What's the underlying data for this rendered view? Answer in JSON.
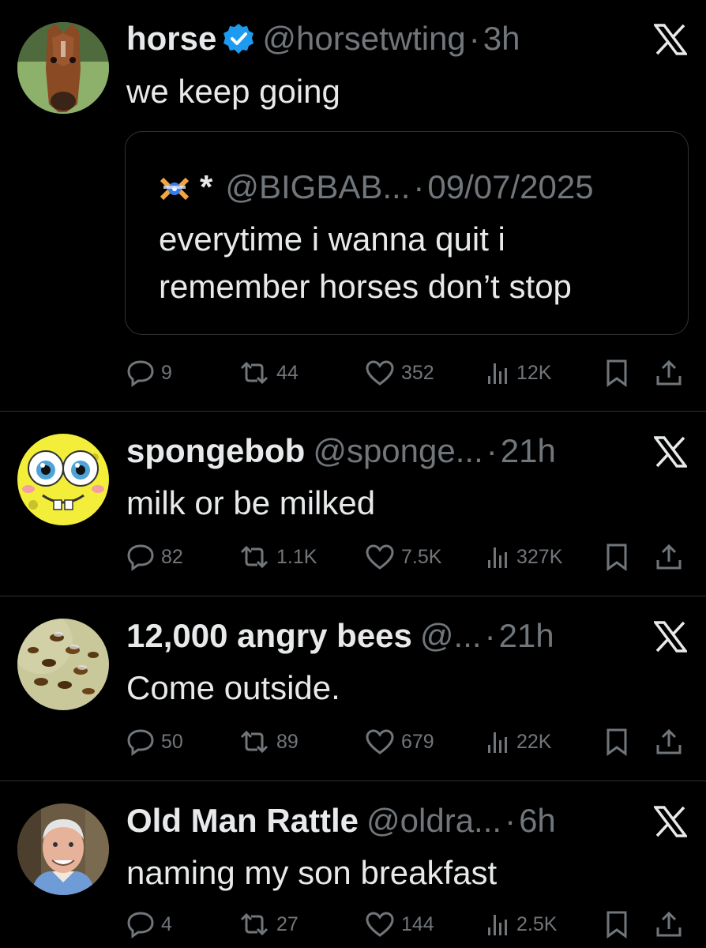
{
  "tweets": [
    {
      "name": "horse",
      "verified": true,
      "handle": "@horsetwting",
      "separator": "·",
      "time": "3h",
      "text": "we keep going",
      "avatar": "horse-photo",
      "quote": {
        "author_symbol": "*",
        "handle": "@BIGBAB...",
        "separator": "·",
        "date": "09/07/2025",
        "line1": "everytime i wanna quit i",
        "line2": "remember horses don’t stop"
      },
      "stats": {
        "replies": "9",
        "reposts": "44",
        "likes": "352",
        "views": "12K"
      }
    },
    {
      "name": "spongebob",
      "handle": "@sponge...",
      "separator": "·",
      "time": "21h",
      "text": "milk or be milked",
      "avatar": "spongebob-face",
      "stats": {
        "replies": "82",
        "reposts": "1.1K",
        "likes": "7.5K",
        "views": "327K"
      }
    },
    {
      "name": "12,000 angry bees",
      "handle": "@...",
      "separator": "·",
      "time": "21h",
      "text": "Come outside.",
      "avatar": "bees-photo",
      "stats": {
        "replies": "50",
        "reposts": "89",
        "likes": "679",
        "views": "22K"
      }
    },
    {
      "name": "Old Man Rattle",
      "handle": "@oldra...",
      "separator": "·",
      "time": "6h",
      "text": "naming my son breakfast",
      "avatar": "old-man-photo",
      "stats": {
        "replies": "4",
        "reposts": "27",
        "likes": "144",
        "views": "2.5K"
      }
    }
  ],
  "colors": {
    "background": "#000000",
    "text": "#e7e9ea",
    "muted": "#71767b",
    "verified": "#1d9bf0",
    "border": "#2f3336"
  },
  "icons": [
    "verified-badge-icon",
    "x-logo-icon",
    "reply-icon",
    "repost-icon",
    "like-icon",
    "views-icon",
    "bookmark-icon",
    "share-icon"
  ]
}
